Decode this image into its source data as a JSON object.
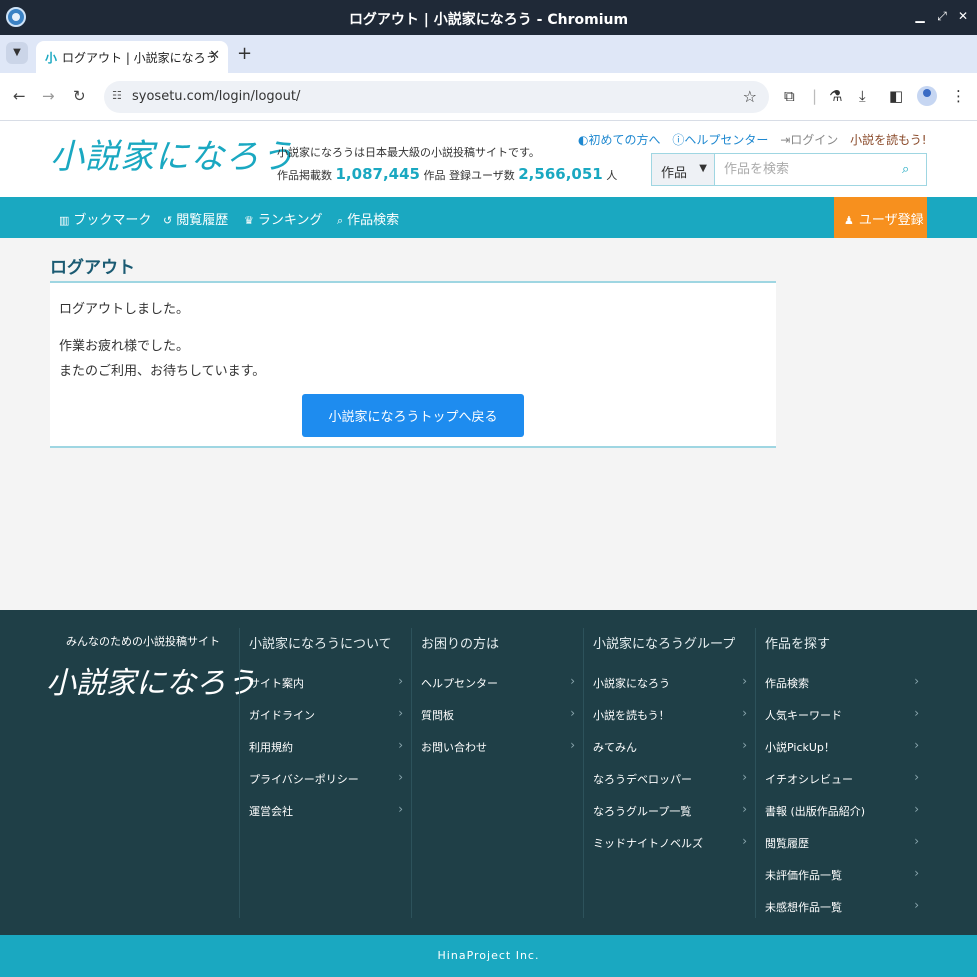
{
  "window": {
    "title": "ログアウト | 小説家になろう - Chromium"
  },
  "tab": {
    "label": "ログアウト | 小説家になろう",
    "favicon": "小"
  },
  "toolbar": {
    "url": "syosetu.com/login/logout/"
  },
  "header": {
    "logo": "小説家になろう",
    "tagline": "小説家になろうは日本最大級の小説投稿サイトです。",
    "works_label": "作品掲載数",
    "works_count": "1,087,445",
    "works_unit": "作品",
    "users_label": "登録ユーザ数",
    "users_count": "2,566,051",
    "users_unit": "人",
    "links": {
      "first_time": "初めての方へ",
      "help_center": "ヘルプセンター",
      "login": "ログイン",
      "yomou": "小説を読もう!"
    },
    "search": {
      "category": "作品",
      "placeholder": "作品を検索"
    }
  },
  "nav": {
    "bookmark": "ブックマーク",
    "history": "閲覧履歴",
    "ranking": "ランキング",
    "search": "作品検索",
    "register": "ユーザ登録"
  },
  "main": {
    "title": "ログアウト",
    "message1": "ログアウトしました。",
    "message2": "作業お疲れ様でした。",
    "message3": "またのご利用、お待ちしています。",
    "button": "小説家になろうトップへ戻る"
  },
  "footer": {
    "tagline": "みんなのための小説投稿サイト",
    "logo": "小説家になろう",
    "columns": [
      {
        "heading": "小説家になろうについて",
        "links": [
          "サイト案内",
          "ガイドライン",
          "利用規約",
          "プライバシーポリシー",
          "運営会社"
        ]
      },
      {
        "heading": "お困りの方は",
        "links": [
          "ヘルプセンター",
          "質問板",
          "お問い合わせ"
        ]
      },
      {
        "heading": "小説家になろうグループ",
        "links": [
          "小説家になろう",
          "小説を読もう！",
          "みてみん",
          "なろうデベロッパー",
          "なろうグループ一覧",
          "ミッドナイトノベルズ"
        ]
      },
      {
        "heading": "作品を探す",
        "links": [
          "作品検索",
          "人気キーワード",
          "小説PickUp！",
          "イチオシレビュー",
          "書報 (出版作品紹介)",
          "閲覧履歴",
          "未評価作品一覧",
          "未感想作品一覧"
        ]
      }
    ],
    "copyright": "HinaProject Inc."
  },
  "colors": {
    "brand": "#1aa8c1",
    "accent_orange": "#f7901e",
    "button_blue": "#1e8cef",
    "footer_bg": "#1f3f47",
    "title_text": "#1a5a72"
  }
}
